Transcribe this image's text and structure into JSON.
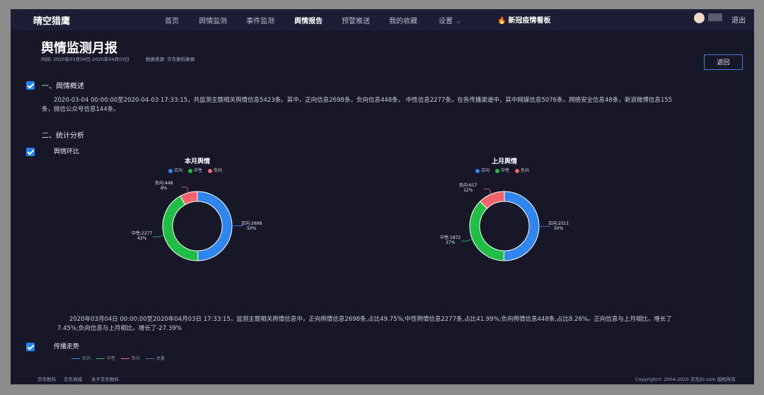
{
  "app": {
    "logo": "晴空猎鹰"
  },
  "nav": {
    "items": [
      {
        "label": "首页",
        "active": false
      },
      {
        "label": "舆情监测",
        "active": false
      },
      {
        "label": "事件监测",
        "active": false
      },
      {
        "label": "舆情报告",
        "active": true
      },
      {
        "label": "预警推送",
        "active": false
      },
      {
        "label": "我的收藏",
        "active": false
      },
      {
        "label": "设置",
        "active": false
      }
    ],
    "hot_board": "新冠疫情看板",
    "logout": "退出"
  },
  "report": {
    "title": "舆情监测月报",
    "time_range": "时间: 2020年03月04日-2020年04月03日",
    "source": "数据来源: 京东数科数据",
    "back_button": "返回"
  },
  "overview": {
    "heading": "一、舆情概述",
    "text": "2020-03-04 00:00:00至2020-04-03 17:33:15，共监测主题相关舆情信息5423条。其中，正向信息2698条，负向信息448条， 中性信息2277条。在各传播渠道中，其中网媒信息5076条，网络安全信息48条，新浪微博信息155条，微信公众号信息144条。"
  },
  "stats": {
    "heading": "二、统计分析",
    "sub_heading": "舆情环比",
    "summary": "2020年03月04日 00:00:00至2020年04月03日 17:33:15，监测主题相关舆情信息中，正向舆情信息2698条,占比49.75%;中性舆情信息2277条,占比41.99%;负向舆情信息448条,占比8.26%。正向信息与上月相比，增长了7.45%;负向信息与上月相比，增长了-27.39%",
    "trend_heading": "传播走势",
    "trend_legend": [
      "正向",
      "中性",
      "负向",
      "总量"
    ]
  },
  "chart_data": [
    {
      "type": "pie",
      "title": "本月舆情",
      "legend": [
        "正向",
        "中性",
        "负向"
      ],
      "colors": [
        "#2f86f0",
        "#1fbf45",
        "#f2636c"
      ],
      "values": [
        2698,
        2277,
        448
      ],
      "labels": [
        {
          "name": "正向:2698",
          "pct": "50%"
        },
        {
          "name": "中性:2277",
          "pct": "42%"
        },
        {
          "name": "负向:448",
          "pct": "8%"
        }
      ]
    },
    {
      "type": "pie",
      "title": "上月舆情",
      "legend": [
        "正向",
        "中性",
        "负向"
      ],
      "colors": [
        "#2f86f0",
        "#1fbf45",
        "#f2636c"
      ],
      "values": [
        2511,
        1872,
        617
      ],
      "labels": [
        {
          "name": "正向:2511",
          "pct": "50%"
        },
        {
          "name": "中性:1872",
          "pct": "37%"
        },
        {
          "name": "负向:617",
          "pct": "12%"
        }
      ]
    }
  ],
  "footer": {
    "links": [
      "京东数科",
      "京东商城",
      "关于京东数科"
    ],
    "copyright": "Copyright© 2004-2020 京东JD.com 版权所有"
  }
}
